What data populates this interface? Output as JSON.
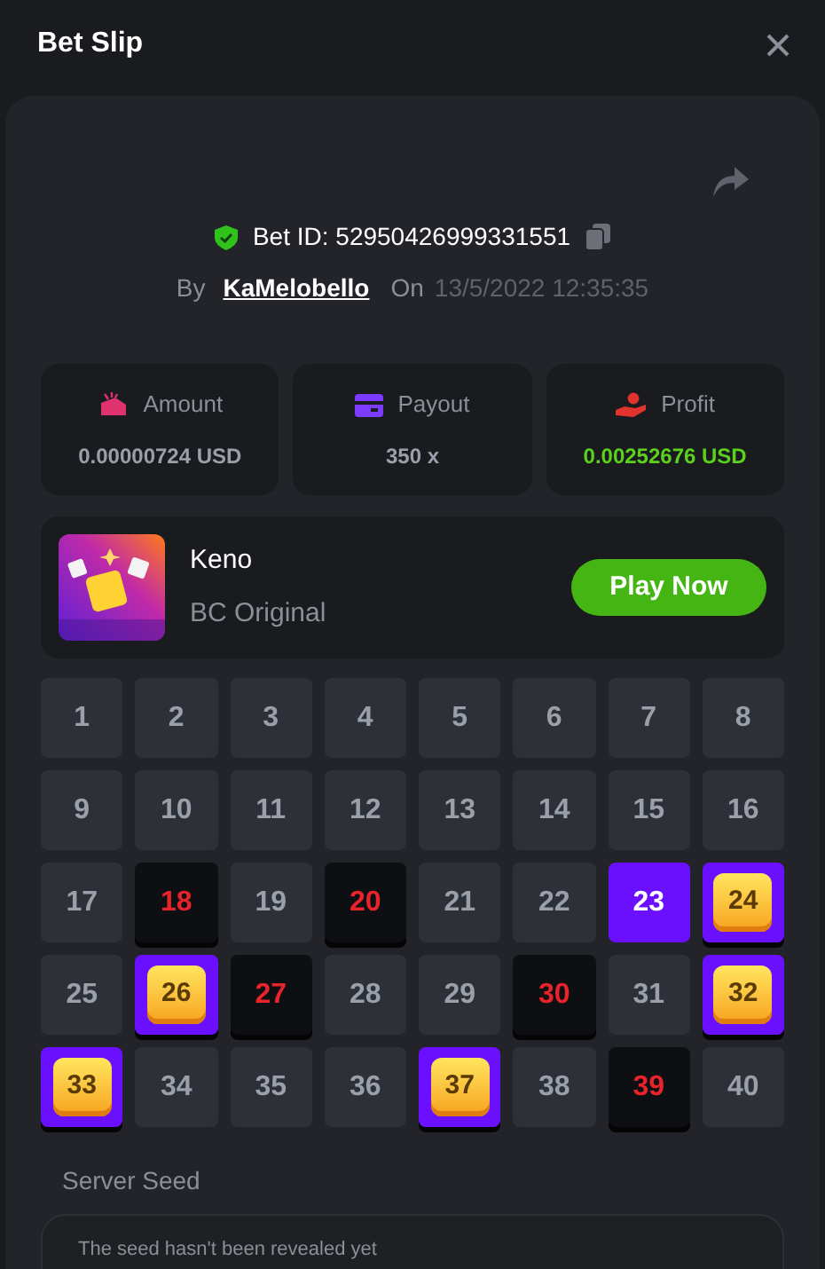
{
  "window": {
    "title": "Bet Slip"
  },
  "bet": {
    "id_label": "Bet ID: 52950426999331551",
    "by_label": "By",
    "user": "KaMelobello",
    "on_label": "On",
    "date": "13/5/2022 12:35:35"
  },
  "stats": [
    {
      "kind": "amount",
      "label": "Amount",
      "value": "0.00000724 USD"
    },
    {
      "kind": "payout",
      "label": "Payout",
      "value": "350 x"
    },
    {
      "kind": "profit",
      "label": "Profit",
      "value": "0.00252676 USD"
    }
  ],
  "game": {
    "name": "Keno",
    "provider": "BC Original",
    "button": "Play Now"
  },
  "cells": [
    {
      "label": "1",
      "kind": "plain"
    },
    {
      "label": "2",
      "kind": "plain"
    },
    {
      "label": "3",
      "kind": "plain"
    },
    {
      "label": "4",
      "kind": "plain"
    },
    {
      "label": "5",
      "kind": "plain"
    },
    {
      "label": "6",
      "kind": "plain"
    },
    {
      "label": "7",
      "kind": "plain"
    },
    {
      "label": "8",
      "kind": "plain"
    },
    {
      "label": "9",
      "kind": "plain"
    },
    {
      "label": "10",
      "kind": "plain"
    },
    {
      "label": "11",
      "kind": "plain"
    },
    {
      "label": "12",
      "kind": "plain"
    },
    {
      "label": "13",
      "kind": "plain"
    },
    {
      "label": "14",
      "kind": "plain"
    },
    {
      "label": "15",
      "kind": "plain"
    },
    {
      "label": "16",
      "kind": "plain"
    },
    {
      "label": "17",
      "kind": "plain"
    },
    {
      "label": "18",
      "kind": "miss"
    },
    {
      "label": "19",
      "kind": "plain"
    },
    {
      "label": "20",
      "kind": "miss"
    },
    {
      "label": "21",
      "kind": "plain"
    },
    {
      "label": "22",
      "kind": "plain"
    },
    {
      "label": "23",
      "kind": "picked"
    },
    {
      "label": "24",
      "kind": "hit"
    },
    {
      "label": "25",
      "kind": "plain"
    },
    {
      "label": "26",
      "kind": "hit"
    },
    {
      "label": "27",
      "kind": "miss"
    },
    {
      "label": "28",
      "kind": "plain"
    },
    {
      "label": "29",
      "kind": "plain"
    },
    {
      "label": "30",
      "kind": "miss"
    },
    {
      "label": "31",
      "kind": "plain"
    },
    {
      "label": "32",
      "kind": "hit"
    },
    {
      "label": "33",
      "kind": "hit"
    },
    {
      "label": "34",
      "kind": "plain"
    },
    {
      "label": "35",
      "kind": "plain"
    },
    {
      "label": "36",
      "kind": "plain"
    },
    {
      "label": "37",
      "kind": "hit"
    },
    {
      "label": "38",
      "kind": "plain"
    },
    {
      "label": "39",
      "kind": "miss"
    },
    {
      "label": "40",
      "kind": "plain"
    }
  ],
  "server_seed": {
    "label": "Server Seed",
    "text": "The seed hasn't been revealed yet"
  }
}
